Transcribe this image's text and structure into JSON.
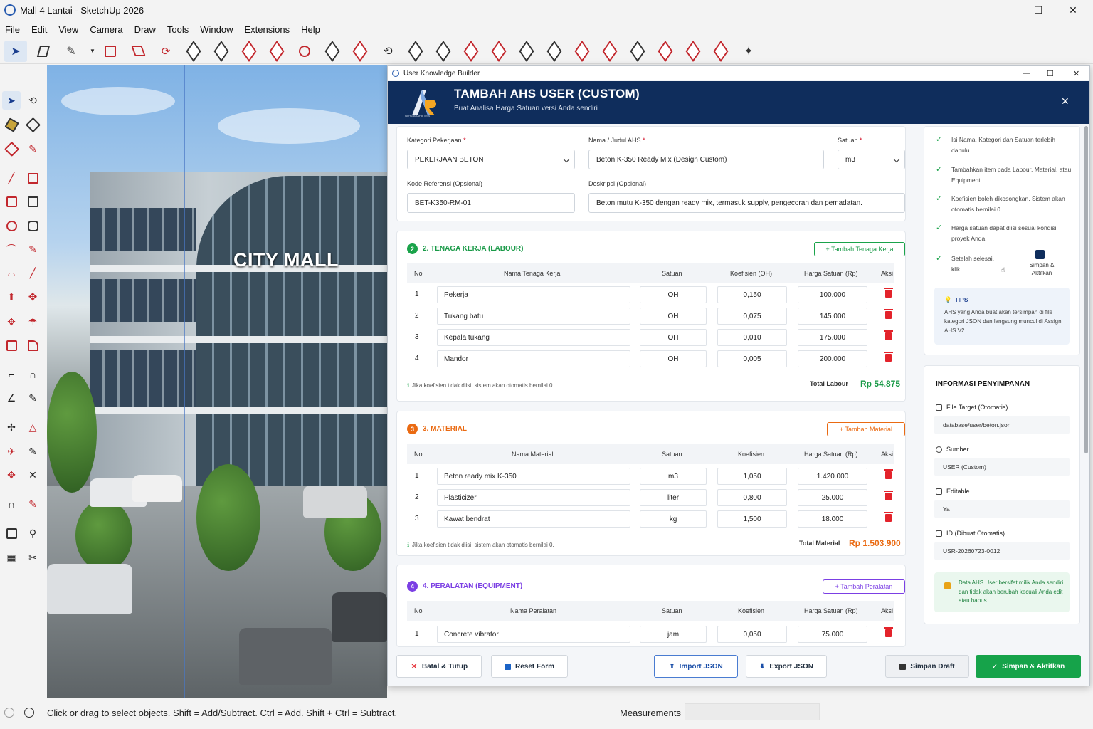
{
  "window": {
    "title": "Mall 4 Lantai - SketchUp 2026"
  },
  "menu": [
    "File",
    "Edit",
    "View",
    "Camera",
    "Draw",
    "Tools",
    "Window",
    "Extensions",
    "Help"
  ],
  "viewport": {
    "sign": "CITY MALL"
  },
  "status": {
    "hint": "Click or drag to select objects. Shift = Add/Subtract. Ctrl = Add. Shift + Ctrl = Subtract.",
    "measurements_label": "Measurements"
  },
  "dialog": {
    "window_title": "User Knowledge Builder",
    "header_title": "TAMBAH AHS USER (CUSTOM)",
    "header_subtitle": "Buat Analisa Harga Satuan versi Anda sendiri",
    "logo_text": "NOYGARAFIE ESS"
  },
  "form": {
    "kategori_label": "Kategori Pekerjaan",
    "kategori_value": "PEKERJAAN BETON",
    "nama_label": "Nama / Judul AHS",
    "nama_value": "Beton K-350 Ready Mix (Design Custom)",
    "satuan_label": "Satuan",
    "satuan_value": "m3",
    "kode_label": "Kode Referensi (Opsional)",
    "kode_value": "BET-K350-RM-01",
    "deskripsi_label": "Deskripsi (Opsional)",
    "deskripsi_value": "Beton mutu K-350 dengan ready mix, termasuk supply, pengecoran dan pemadatan.",
    "required_mark": "*"
  },
  "labour": {
    "num": "2",
    "title": "2. TENAGA KERJA (LABOUR)",
    "add_label": "+ Tambah Tenaga Kerja",
    "headers": [
      "No",
      "Nama Tenaga Kerja",
      "Satuan",
      "Koefisien (OH)",
      "Harga Satuan (Rp)",
      "Aksi"
    ],
    "rows": [
      {
        "no": "1",
        "nama": "Pekerja",
        "satuan": "OH",
        "koef": "0,150",
        "harga": "100.000"
      },
      {
        "no": "2",
        "nama": "Tukang batu",
        "satuan": "OH",
        "koef": "0,075",
        "harga": "145.000"
      },
      {
        "no": "3",
        "nama": "Kepala tukang",
        "satuan": "OH",
        "koef": "0,010",
        "harga": "175.000"
      },
      {
        "no": "4",
        "nama": "Mandor",
        "satuan": "OH",
        "koef": "0,005",
        "harga": "200.000"
      }
    ],
    "note": "Jika koefisien tidak diisi, sistem akan otomatis bernilai 0.",
    "total_label": "Total Labour",
    "total_value": "Rp 54.875"
  },
  "material": {
    "num": "3",
    "title": "3. MATERIAL",
    "add_label": "+ Tambah Material",
    "headers": [
      "No",
      "Nama Material",
      "Satuan",
      "Koefisien",
      "Harga Satuan (Rp)",
      "Aksi"
    ],
    "rows": [
      {
        "no": "1",
        "nama": "Beton ready mix K-350",
        "satuan": "m3",
        "koef": "1,050",
        "harga": "1.420.000"
      },
      {
        "no": "2",
        "nama": "Plasticizer",
        "satuan": "liter",
        "koef": "0,800",
        "harga": "25.000"
      },
      {
        "no": "3",
        "nama": "Kawat bendrat",
        "satuan": "kg",
        "koef": "1,500",
        "harga": "18.000"
      }
    ],
    "note": "Jika koefisien tidak diisi, sistem akan otomatis bernilai 0.",
    "total_label": "Total Material",
    "total_value": "Rp 1.503.900"
  },
  "equipment": {
    "num": "4",
    "title": "4. PERALATAN (EQUIPMENT)",
    "add_label": "+ Tambah Peralatan",
    "headers": [
      "No",
      "Nama Peralatan",
      "Satuan",
      "Koefisien",
      "Harga Satuan (Rp)",
      "Aksi"
    ],
    "rows": [
      {
        "no": "1",
        "nama": "Concrete vibrator",
        "satuan": "jam",
        "koef": "0,050",
        "harga": "75.000"
      }
    ]
  },
  "checklist": [
    "Isi Nama, Kategori dan Satuan terlebih dahulu.",
    "Tambahkan item pada Labour, Material, atau Equipment.",
    "Koefisien boleh dikosongkan. Sistem akan otomatis bernilai 0.",
    "Harga satuan dapat diisi sesuai kondisi proyek Anda.",
    "Setelah selesai, klik"
  ],
  "checklist_save": "Simpan & Aktifkan",
  "tips": {
    "title": "TIPS",
    "text": "AHS yang Anda buat akan tersimpan di file kategori JSON dan langsung muncul di Assign AHS V2."
  },
  "info": {
    "title": "INFORMASI PENYIMPANAN",
    "file_label": "File Target (Otomatis)",
    "file_value": "database/user/beton.json",
    "sumber_label": "Sumber",
    "sumber_value": "USER  (Custom)",
    "editable_label": "Editable",
    "editable_value": "Ya",
    "id_label": "ID (Dibuat Otomatis)",
    "id_value": "USR-20260723-0012",
    "lock_note": "Data AHS User bersifat milik Anda sendiri dan tidak akan berubah kecuali Anda edit atau hapus."
  },
  "footer": {
    "batal": "Batal & Tutup",
    "reset": "Reset Form",
    "import": "Import JSON",
    "export": "Export JSON",
    "draft": "Simpan Draft",
    "simpan": "Simpan & Aktifkan"
  },
  "colors": {
    "header_bg": "#0f2d5c",
    "green": "#1aa34a",
    "orange": "#ea6a12",
    "purple": "#7b3fe4",
    "red": "#e3232b"
  }
}
